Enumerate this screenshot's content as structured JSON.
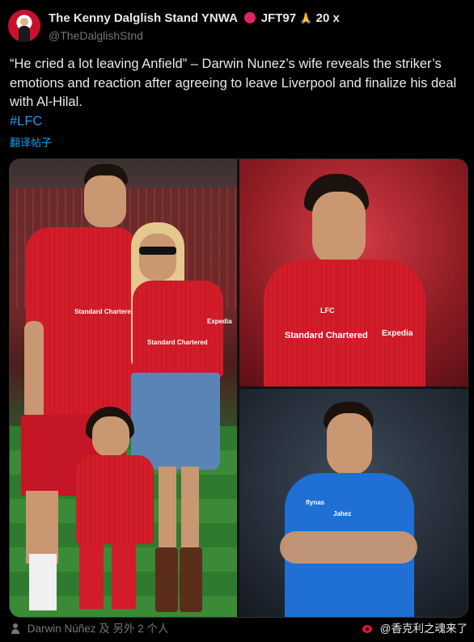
{
  "header": {
    "display_name": "The Kenny Dalglish Stand YNWA",
    "name_suffix": "JFT97",
    "name_count": "20 x",
    "handle": "@TheDalglishStnd",
    "more_icon": "more-horizontal-icon"
  },
  "tweet": {
    "text": "“He cried a lot leaving Anfield” – Darwin Nunez’s wife reveals the striker’s emotions and reaction after agreeing to leave Liverpool and finalize his deal with Al-Hilal.",
    "hashtag": "#LFC",
    "translate_label": "翻译帖子"
  },
  "media": {
    "photos": [
      {
        "alt_role": "family-photo-anfield",
        "kit_text_1": "Standard Chartered",
        "kit_text_2": "Expedia",
        "kit_text_3": "Standard Chartered"
      },
      {
        "alt_role": "player-portrait-liverpool-kit",
        "kit_text_1": "LFC",
        "kit_text_2": "Standard Chartered",
        "kit_text_3": "Expedia"
      },
      {
        "alt_role": "player-portrait-al-hilal-kit",
        "kit_text_1": "flynas",
        "kit_text_2": "Jahez"
      }
    ]
  },
  "footer": {
    "tagged_people": "Darwin Núñez 及 另外 2 个人",
    "watermark": "@香克利之魂来了"
  },
  "colors": {
    "background": "#000000",
    "text": "#e7e9ea",
    "muted": "#71767b",
    "link": "#1d9bf0",
    "liverpool_red": "#d21c2a",
    "alhilal_blue": "#1f6fd4"
  }
}
